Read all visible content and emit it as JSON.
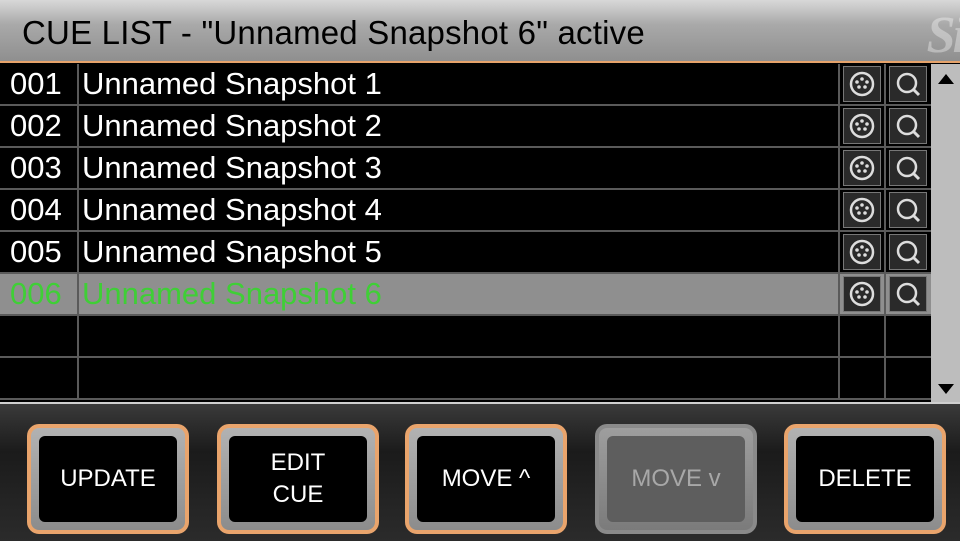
{
  "header": {
    "title": "CUE LIST - \"Unnamed Snapshot 6\" active",
    "logo": "Si"
  },
  "cues": [
    {
      "number": "001",
      "name": "Unnamed Snapshot 1",
      "active": false
    },
    {
      "number": "002",
      "name": "Unnamed Snapshot 2",
      "active": false
    },
    {
      "number": "003",
      "name": "Unnamed Snapshot 3",
      "active": false
    },
    {
      "number": "004",
      "name": "Unnamed Snapshot 4",
      "active": false
    },
    {
      "number": "005",
      "name": "Unnamed Snapshot 5",
      "active": false
    },
    {
      "number": "006",
      "name": "Unnamed Snapshot 6",
      "active": true
    },
    {
      "number": "",
      "name": "",
      "active": false
    },
    {
      "number": "",
      "name": "",
      "active": false
    }
  ],
  "row_icons": [
    "midi-connector-icon",
    "recall-icon"
  ],
  "buttons": {
    "update": "UPDATE",
    "edit_cue": "EDIT\nCUE",
    "move_up": "MOVE ^",
    "move_down": "MOVE v",
    "delete": "DELETE"
  },
  "colors": {
    "active_text": "#3fcf36",
    "active_row": "#8f8f8f",
    "button_border": "#e9a46c"
  }
}
